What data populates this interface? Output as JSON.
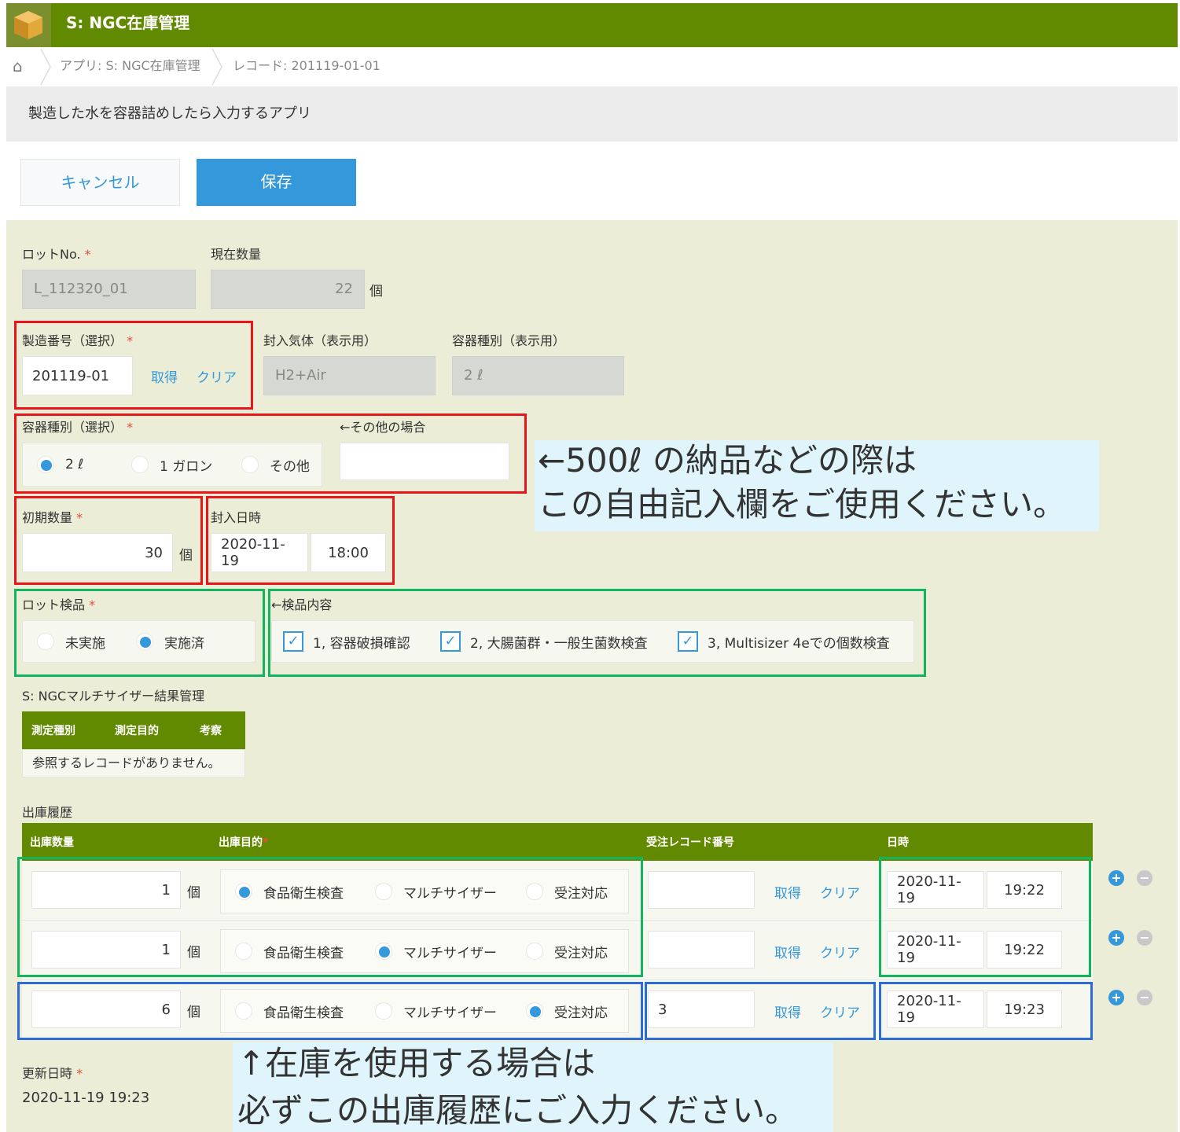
{
  "header": {
    "title": "S: NGC在庫管理"
  },
  "breadcrumb": {
    "app": "アプリ: S: NGC在庫管理",
    "record": "レコード: 201119-01-01"
  },
  "description": "製造した水を容器詰めしたら入力するアプリ",
  "toolbar": {
    "cancel_label": "キャンセル",
    "save_label": "保存"
  },
  "fields": {
    "lot_no": {
      "label": "ロットNo.",
      "req": "*",
      "value": "L_112320_01"
    },
    "current_qty": {
      "label": "現在数量",
      "value": "22",
      "unit": "個"
    },
    "mfg_no": {
      "label": "製造番号（選択）",
      "req": "*",
      "value": "201119-01",
      "get": "取得",
      "clear": "クリア"
    },
    "gas": {
      "label": "封入気体（表示用）",
      "value": "H2+Air"
    },
    "container_display": {
      "label": "容器種別（表示用）",
      "value": "2 ℓ"
    },
    "container_select": {
      "label": "容器種別（選択）",
      "req": "*",
      "options": [
        "2 ℓ",
        "1 ガロン",
        "その他"
      ],
      "selected": "2 ℓ"
    },
    "other": {
      "label": "←その他の場合",
      "value": ""
    },
    "initial_qty": {
      "label": "初期数量",
      "req": "*",
      "value": "30",
      "unit": "個"
    },
    "seal_datetime": {
      "label": "封入日時",
      "date": "2020-11-19",
      "time": "18:00"
    },
    "lot_inspection": {
      "label": "ロット検品",
      "req": "*",
      "options": [
        "未実施",
        "実施済"
      ],
      "selected": "実施済"
    },
    "inspection_content": {
      "label": "←検品内容",
      "items": [
        "1, 容器破損確認",
        "2, 大腸菌群・一般生菌数検査",
        "3, Multisizer 4eでの個数検査"
      ]
    },
    "multisizer": {
      "label": "S: NGCマルチサイザー結果管理",
      "cols": [
        "測定種別",
        "測定目的",
        "考察"
      ],
      "empty": "参照するレコードがありません。"
    },
    "shipping": {
      "label": "出庫履歴",
      "cols": {
        "qty": "出庫数量",
        "purpose": "出庫目的",
        "req": "*",
        "order": "受注レコード番号",
        "datetime": "日時"
      },
      "purpose_options": [
        "食品衛生検査",
        "マルチサイザー",
        "受注対応"
      ],
      "get": "取得",
      "clear": "クリア",
      "unit": "個",
      "rows": [
        {
          "qty": "1",
          "purpose": "食品衛生検査",
          "order": "",
          "date": "2020-11-19",
          "time": "19:22"
        },
        {
          "qty": "1",
          "purpose": "マルチサイザー",
          "order": "",
          "date": "2020-11-19",
          "time": "19:22"
        },
        {
          "qty": "6",
          "purpose": "受注対応",
          "order": "3",
          "date": "2020-11-19",
          "time": "19:23"
        }
      ]
    },
    "updated": {
      "label": "更新日時",
      "req": "*",
      "value": "2020-11-19 19:23"
    }
  },
  "notes": {
    "note1_line1": "←500ℓ の納品などの際は",
    "note1_line2": "この自由記入欄をご使用ください。",
    "note2_line1": "↑在庫を使用する場合は",
    "note2_line2": "必ずこの出庫履歴にご入力ください。"
  },
  "colors": {
    "header": "#628a00",
    "accent": "#3498db",
    "form_bg": "#ebedd6"
  }
}
